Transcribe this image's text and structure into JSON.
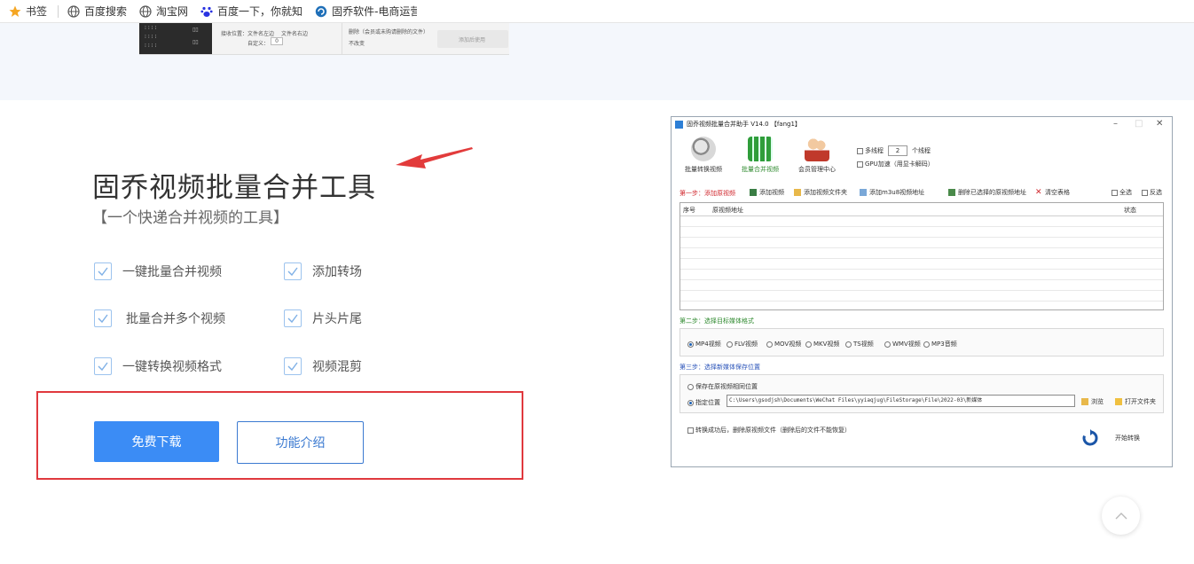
{
  "bookmarks": [
    {
      "label": "书签",
      "icon": "star-icon"
    },
    {
      "label": "百度搜索",
      "icon": "globe-icon"
    },
    {
      "label": "淘宝网",
      "icon": "globe-icon"
    },
    {
      "label": "百度一下，你就知",
      "icon": "baidu-paw-icon"
    },
    {
      "label": "固乔软件-电商运营",
      "icon": "guqiao-logo-icon"
    }
  ],
  "top_shot": {
    "line1": "接收位置：",
    "opt1": "文件名左边",
    "opt2": "文件名右边",
    "opt3": "自定义：",
    "opt3_value": "0",
    "opt4": "删除（会员或未购请删除的文件）",
    "opt5": "不改变",
    "action": "添加后使用"
  },
  "hero": {
    "title": "固乔视频批量合并工具",
    "subtitle": "【一个快递合并视频的工具】",
    "features": [
      "一键批量合并视频",
      "添加转场",
      "批量合并多个视频",
      "片头片尾",
      "一键转换视频格式",
      "视频混剪"
    ],
    "download_label": "免费下载",
    "intro_label": "功能介绍"
  },
  "colors": {
    "accent": "#3b8cf5",
    "highlight_red": "#e0393e",
    "check_blue": "#9cc3ee"
  },
  "app": {
    "title": "固乔视频批量合并助手 V14.0 【fang1】",
    "tools": [
      "批量转换视频",
      "批量合并视频",
      "会员管理中心"
    ],
    "multi_thread_label": "多线程",
    "thread_count": "2",
    "thread_unit": "个线程",
    "gpu_label": "GPU加速（用显卡解码）",
    "step1": "第一步：添加原视频",
    "toolbar": [
      "添加视频",
      "添加视频文件夹",
      "添加m3u8视频地址",
      "删除已选择的原视频地址",
      "清空表格"
    ],
    "select_all": "全选",
    "invert": "反选",
    "columns": [
      "序号",
      "原视频地址",
      "状态"
    ],
    "step2": "第二步：选择目标媒体格式",
    "formats": [
      "MP4视频",
      "FLV视频",
      "MOV视频",
      "MKV视频",
      "TS视频",
      "WMV视频",
      "MP3音频"
    ],
    "step3": "第三步：选择新媒体保存位置",
    "save_same": "保存在原视频相同位置",
    "save_custom": "指定位置",
    "save_path": "C:\\Users\\gsodjsh\\Documents\\WeChat Files\\yyiaqjug\\FileStorage\\File\\2022-03\\新媒体",
    "browse": "浏览",
    "open_folder": "打开文件夹",
    "delete_after": "转换成功后，删除原视频文件（删除后的文件不能恢复）",
    "start": "开始转换"
  }
}
